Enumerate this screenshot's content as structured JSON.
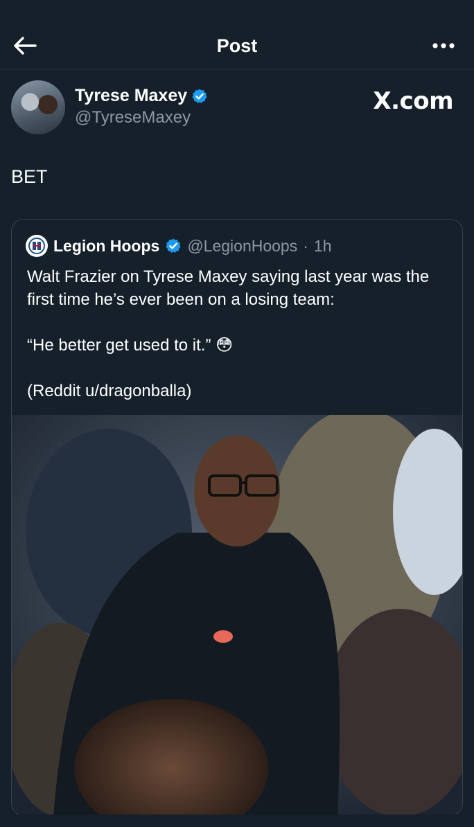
{
  "header": {
    "title": "Post"
  },
  "author": {
    "name": "Tyrese Maxey",
    "handle": "@TyreseMaxey",
    "verified": true
  },
  "watermark": "X.com",
  "post": {
    "text": "BET"
  },
  "quoted": {
    "name": "Legion Hoops",
    "handle": "@LegionHoops",
    "separator": "·",
    "time": "1h",
    "verified": true,
    "line1": "Walt Frazier on Tyrese Maxey saying last year was the first time he’s ever been on a losing team:",
    "line2": "“He better get used to it.” 😳",
    "line3": "(Reddit u/dragonballa)"
  },
  "colors": {
    "background": "#15202b",
    "verified_blue": "#1d9bf0",
    "secondary_text": "#8b98a5",
    "border": "#38444d"
  },
  "icons": {
    "back": "arrow-left-icon",
    "more": "more-horizontal-icon",
    "verified": "verified-badge-icon",
    "quoted_avatar": "legion-hoops-logo"
  }
}
